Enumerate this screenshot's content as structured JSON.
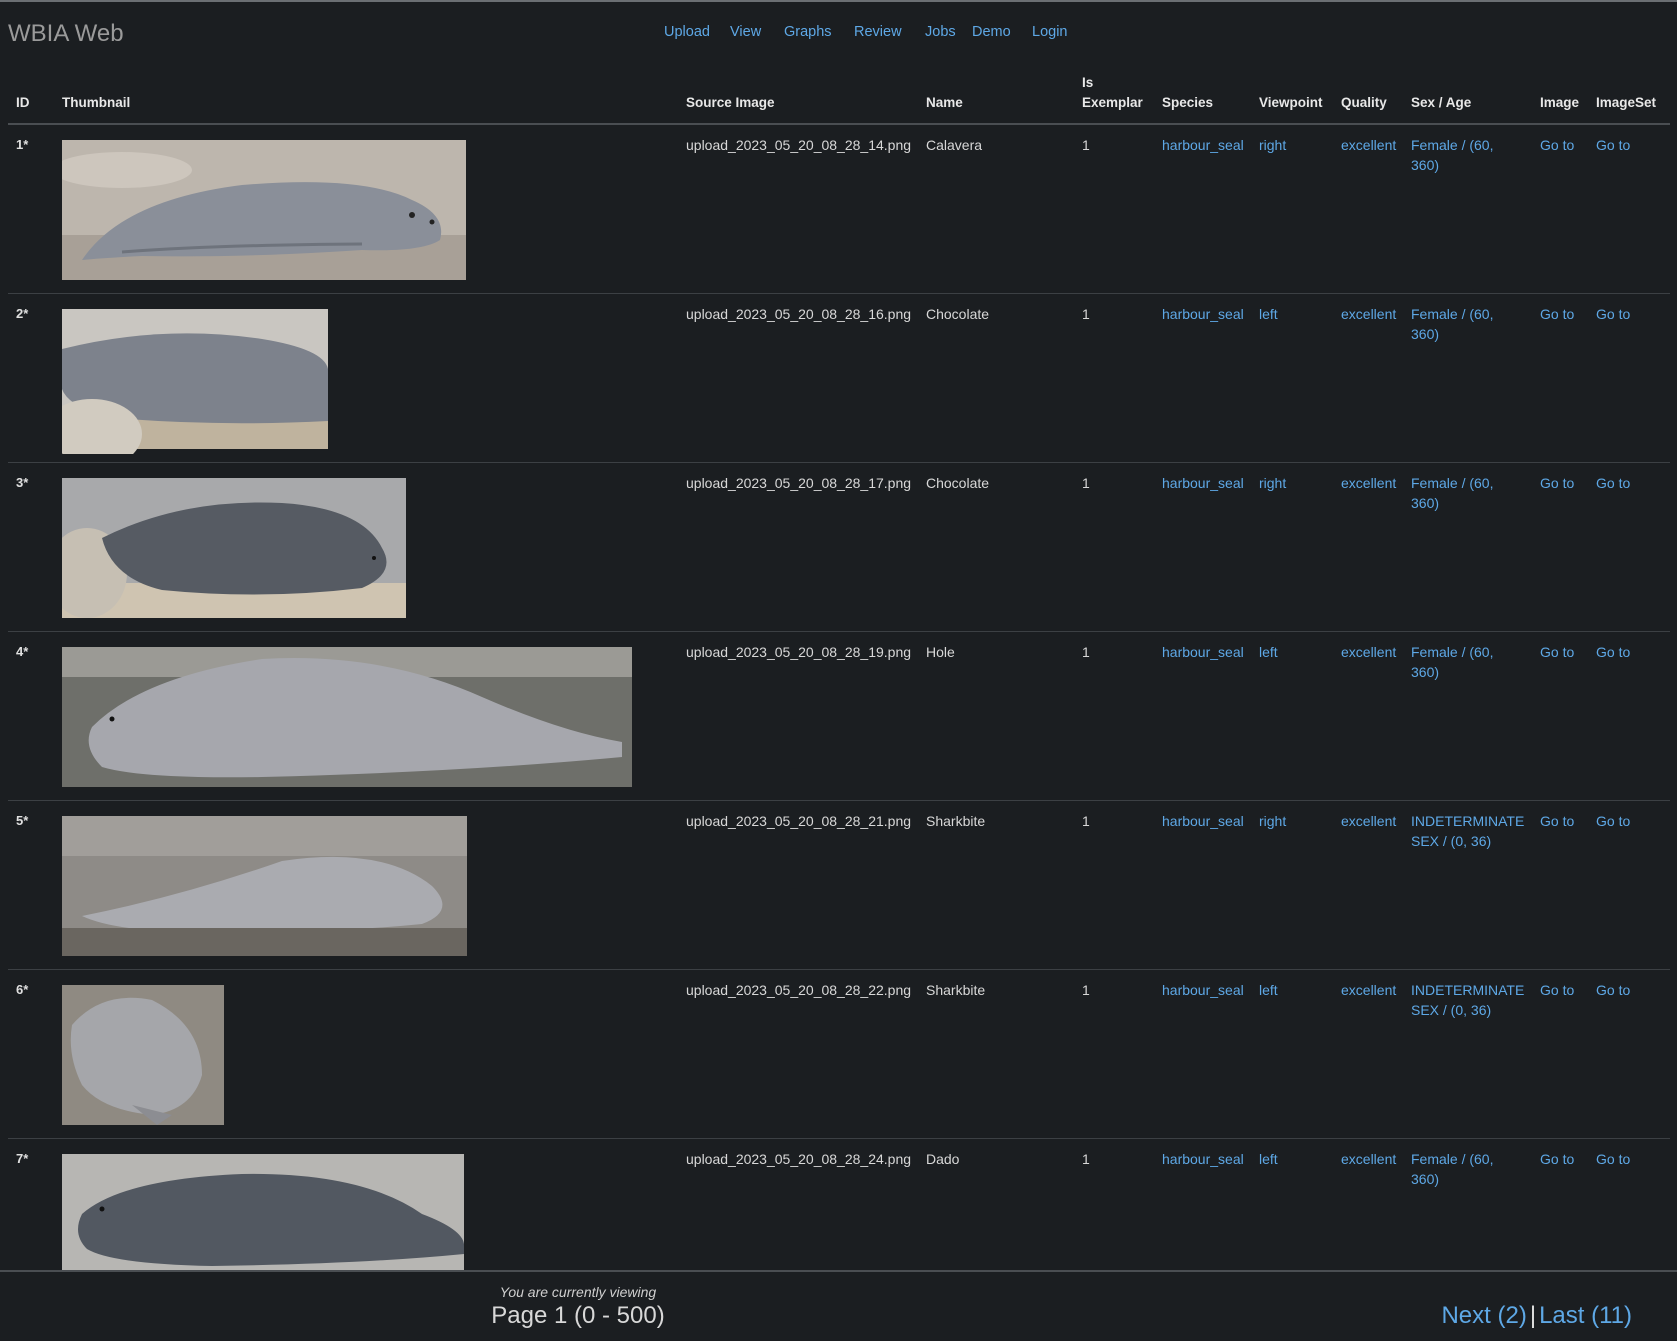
{
  "app": {
    "brand": "WBIA Web"
  },
  "nav": [
    {
      "label": "Upload"
    },
    {
      "label": "View"
    },
    {
      "label": "Graphs"
    },
    {
      "label": "Review"
    },
    {
      "label": "Jobs"
    },
    {
      "label": "Demo"
    },
    {
      "label": "Login"
    }
  ],
  "table": {
    "headers": {
      "id": "ID",
      "thumbnail": "Thumbnail",
      "source_image": "Source Image",
      "name": "Name",
      "is_exemplar_1": "Is",
      "is_exemplar_2": "Exemplar",
      "species": "Species",
      "viewpoint": "Viewpoint",
      "quality": "Quality",
      "sex_age": "Sex / Age",
      "image": "Image",
      "imageset": "ImageSet"
    },
    "rows": [
      {
        "id": "1*",
        "source": "upload_2023_05_20_08_28_14.png",
        "name": "Calavera",
        "exemplar": "1",
        "species": "harbour_seal",
        "viewpoint": "right",
        "quality": "excellent",
        "sex_age": "Female / (60, 360)",
        "image_link": "Go to",
        "imageset_link": "Go to"
      },
      {
        "id": "2*",
        "source": "upload_2023_05_20_08_28_16.png",
        "name": "Chocolate",
        "exemplar": "1",
        "species": "harbour_seal",
        "viewpoint": "left",
        "quality": "excellent",
        "sex_age": "Female / (60, 360)",
        "image_link": "Go to",
        "imageset_link": "Go to"
      },
      {
        "id": "3*",
        "source": "upload_2023_05_20_08_28_17.png",
        "name": "Chocolate",
        "exemplar": "1",
        "species": "harbour_seal",
        "viewpoint": "right",
        "quality": "excellent",
        "sex_age": "Female / (60, 360)",
        "image_link": "Go to",
        "imageset_link": "Go to"
      },
      {
        "id": "4*",
        "source": "upload_2023_05_20_08_28_19.png",
        "name": "Hole",
        "exemplar": "1",
        "species": "harbour_seal",
        "viewpoint": "left",
        "quality": "excellent",
        "sex_age": "Female / (60, 360)",
        "image_link": "Go to",
        "imageset_link": "Go to"
      },
      {
        "id": "5*",
        "source": "upload_2023_05_20_08_28_21.png",
        "name": "Sharkbite",
        "exemplar": "1",
        "species": "harbour_seal",
        "viewpoint": "right",
        "quality": "excellent",
        "sex_age": "INDETERMINATE SEX / (0, 36)",
        "image_link": "Go to",
        "imageset_link": "Go to"
      },
      {
        "id": "6*",
        "source": "upload_2023_05_20_08_28_22.png",
        "name": "Sharkbite",
        "exemplar": "1",
        "species": "harbour_seal",
        "viewpoint": "left",
        "quality": "excellent",
        "sex_age": "INDETERMINATE SEX / (0, 36)",
        "image_link": "Go to",
        "imageset_link": "Go to"
      },
      {
        "id": "7*",
        "source": "upload_2023_05_20_08_28_24.png",
        "name": "Dado",
        "exemplar": "1",
        "species": "harbour_seal",
        "viewpoint": "left",
        "quality": "excellent",
        "sex_age": "Female / (60, 360)",
        "image_link": "Go to",
        "imageset_link": "Go to"
      }
    ]
  },
  "footer": {
    "viewing": "You are currently viewing",
    "page": "Page 1 (0 - 500)",
    "next": "Next (2)",
    "separator": "|",
    "last": "Last (11)"
  },
  "colors": {
    "background": "#1b1e21",
    "link": "#5ea8e6",
    "text": "#d8d8d8"
  }
}
